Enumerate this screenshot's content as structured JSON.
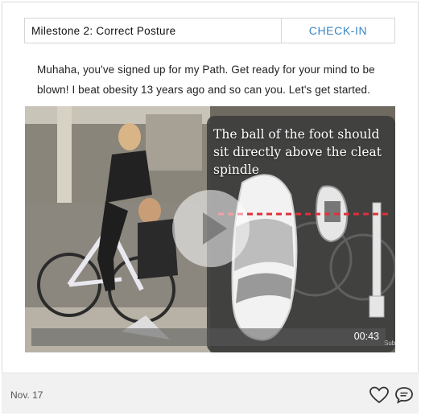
{
  "milestone": {
    "title": "Milestone 2:  Correct Posture",
    "checkin_label": "CHECK-IN"
  },
  "post": {
    "message": "Muhaha, you've signed up for my Path. Get ready for your mind to be blown! I beat obesity 13 years ago and so can you. Let's get started."
  },
  "video": {
    "caption": "The ball of the foot should sit directly above the cleat spindle",
    "duration": "00:43",
    "subscribe_text": "Subsc"
  },
  "footer": {
    "date": "Nov. 17"
  },
  "colors": {
    "accent": "#3a85c2",
    "cleat_line": "#e0303a"
  },
  "icons": [
    "play-icon",
    "heart-icon",
    "comment-icon"
  ]
}
